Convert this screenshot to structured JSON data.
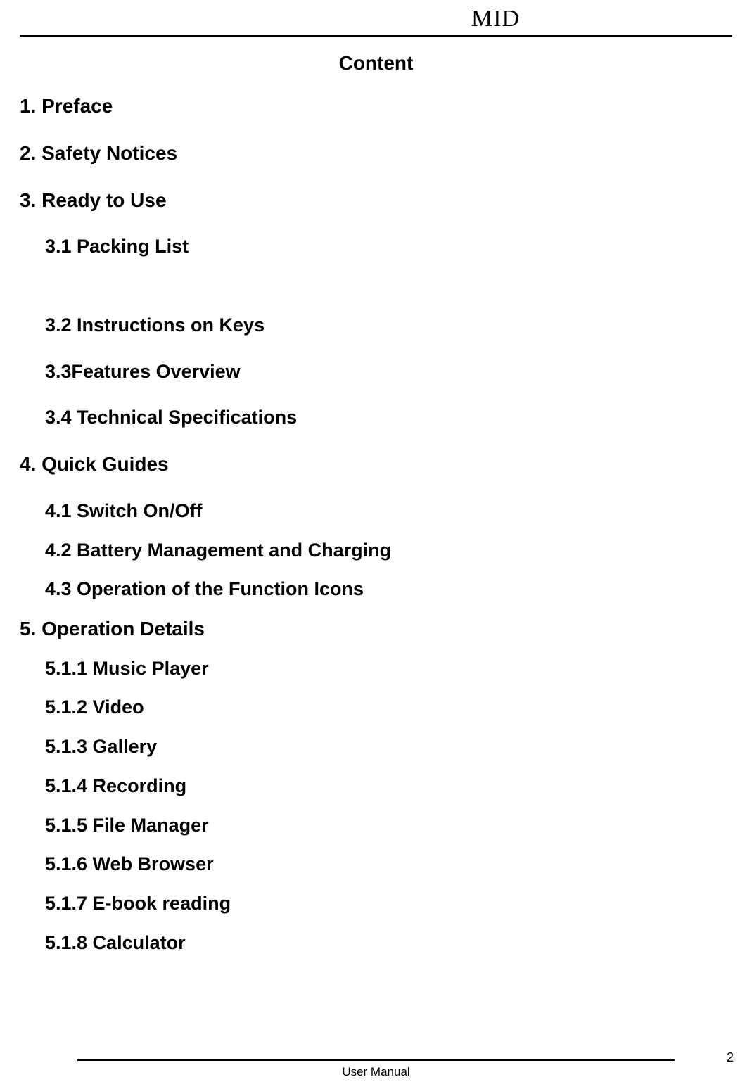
{
  "header": {
    "title": "MID"
  },
  "content_heading": "Content",
  "toc": [
    {
      "level": 1,
      "text": "1. Preface"
    },
    {
      "level": 1,
      "text": "2. Safety Notices"
    },
    {
      "level": 1,
      "text": "3. Ready to Use"
    },
    {
      "level": 2,
      "text": "3.1 Packing List",
      "gap_after": true
    },
    {
      "level": 2,
      "text": "3.2 Instructions on Keys"
    },
    {
      "level": 2,
      "text": "3.3Features Overview"
    },
    {
      "level": 2,
      "text": "3.4 Technical Specifications"
    },
    {
      "level": 1,
      "text": "4. Quick Guides"
    },
    {
      "level": 2,
      "text": "4.1 Switch On/Off",
      "tight": true
    },
    {
      "level": 2,
      "text": "4.2 Battery Management and Charging",
      "tight": true
    },
    {
      "level": 2,
      "text": "4.3 Operation of the Function Icons",
      "tight": true
    },
    {
      "level": 1,
      "text": "5. Operation Details",
      "tight": true
    },
    {
      "level": 2,
      "text": "5.1.1 Music Player",
      "tight": true
    },
    {
      "level": 2,
      "text": "5.1.2 Video",
      "tight": true
    },
    {
      "level": 2,
      "text": "5.1.3 Gallery",
      "tight": true
    },
    {
      "level": 2,
      "text": "5.1.4 Recording",
      "tight": true
    },
    {
      "level": 2,
      "text": "5.1.5 File Manager",
      "tight": true
    },
    {
      "level": 2,
      "text": "5.1.6 Web Browser",
      "tight": true
    },
    {
      "level": 2,
      "text": "5.1.7 E-book reading",
      "tight": true
    },
    {
      "level": 2,
      "text": "5.1.8 Calculator",
      "tight": true
    }
  ],
  "footer": {
    "text": "User Manual",
    "page_number": "2"
  }
}
